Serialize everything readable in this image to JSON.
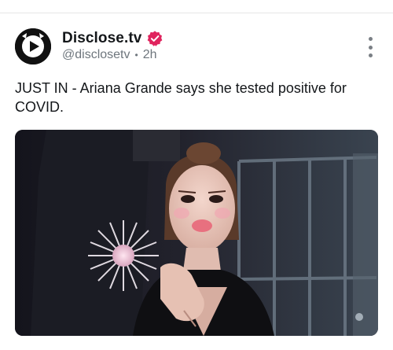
{
  "post": {
    "author": {
      "display_name": "Disclose.tv",
      "handle": "@disclosetv",
      "verified": true,
      "avatar_icon": "play-arrow-logo-icon"
    },
    "time_ago": "2h",
    "separator": "•",
    "text": "JUST IN - Ariana Grande says she tested positive for COVID.",
    "more_icon": "vertical-ellipsis-icon",
    "media": {
      "type": "photo"
    }
  },
  "colors": {
    "verified_badge": "#e0245e",
    "meta_text": "#6e767d",
    "text": "#14171a"
  }
}
